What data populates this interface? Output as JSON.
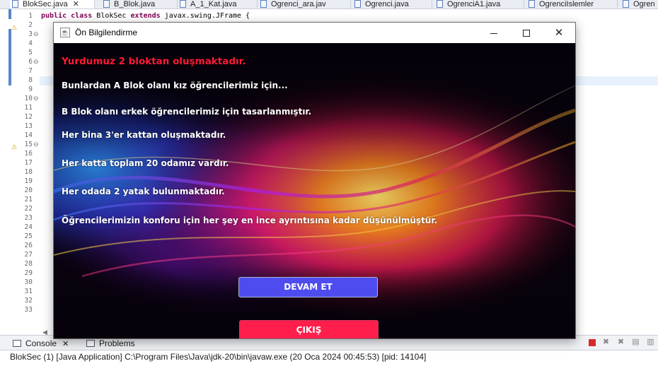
{
  "editor_tabs": [
    {
      "label": "BlokSec.java",
      "active": true
    },
    {
      "label": "B_Blok.java"
    },
    {
      "label": "A_1_Kat.java"
    },
    {
      "label": "Ogrenci_ara.jav"
    },
    {
      "label": "Ogrenci.java"
    },
    {
      "label": "OgrenciA1.java"
    },
    {
      "label": "OgrenciIslemler"
    },
    {
      "label": "Ogren"
    }
  ],
  "code": {
    "line1_kw1": "public",
    "line1_kw2": "class",
    "line1_name": "BlokSec",
    "line1_kw3": "extends",
    "line1_rest": "javax.swing.JFrame {"
  },
  "line_numbers": [
    "1",
    "2",
    "3",
    "4",
    "5",
    "6",
    "7",
    "8",
    "9",
    "10",
    "11",
    "12",
    "13",
    "14",
    "15",
    "16",
    "17",
    "18",
    "19",
    "20",
    "21",
    "22",
    "23",
    "24",
    "25",
    "26",
    "27",
    "28",
    "29",
    "30",
    "31",
    "32",
    "33"
  ],
  "console": {
    "tab_console": "Console",
    "tab_problems": "Problems",
    "status": "BlokSec (1) [Java Application] C:\\Program Files\\Java\\jdk-20\\bin\\javaw.exe  (20 Oca 2024 00:45:53) [pid: 14104]"
  },
  "dialog": {
    "title": "Ön Bilgilendirme",
    "heading": "Yurdumuz 2 bloktan oluşmaktadır.",
    "lines": [
      "Bunlardan A Blok olanı kız öğrencilerimiz için...",
      "B Blok olanı erkek öğrencilerimiz için tasarlanmıştır.",
      "Her bina 3'er kattan oluşmaktadır.",
      "Her katta toplam 20 odamız vardır.",
      "Her odada 2 yatak bulunmaktadır.",
      "Öğrencilerimizin konforu için her şey en ince ayrıntısına kadar düşünülmüştür."
    ],
    "continue_label": "DEVAM ET",
    "exit_label": "ÇIKIŞ",
    "colors": {
      "heading": "#ff1a35",
      "continue_button": "#4f4cef",
      "exit_button": "#ff1e4c"
    }
  }
}
